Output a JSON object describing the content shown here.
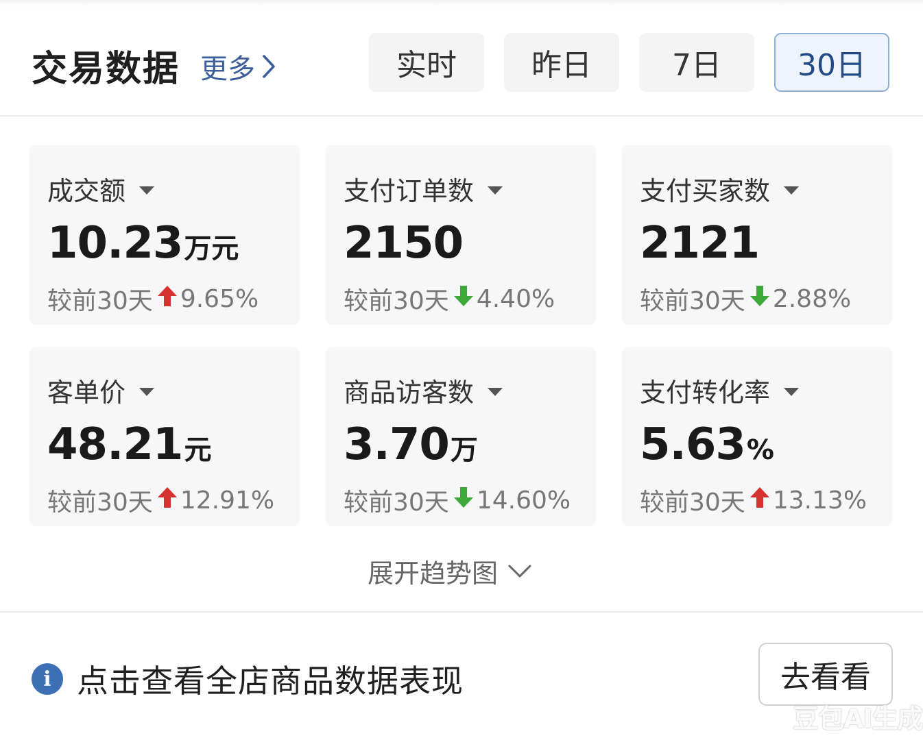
{
  "header": {
    "title": "交易数据",
    "more_label": "更多",
    "tabs": [
      {
        "label": "实时",
        "active": false
      },
      {
        "label": "昨日",
        "active": false
      },
      {
        "label": "7日",
        "active": false
      },
      {
        "label": "30日",
        "active": true
      }
    ]
  },
  "metrics": [
    {
      "label": "成交额",
      "value": "10.23",
      "unit": "万元",
      "compare_text": "较前30天",
      "direction": "up",
      "change": "9.65%"
    },
    {
      "label": "支付订单数",
      "value": "2150",
      "unit": "",
      "compare_text": "较前30天",
      "direction": "down",
      "change": "4.40%"
    },
    {
      "label": "支付买家数",
      "value": "2121",
      "unit": "",
      "compare_text": "较前30天",
      "direction": "down",
      "change": "2.88%"
    },
    {
      "label": "客单价",
      "value": "48.21",
      "unit": "元",
      "compare_text": "较前30天",
      "direction": "up",
      "change": "12.91%"
    },
    {
      "label": "商品访客数",
      "value": "3.70",
      "unit": "万",
      "compare_text": "较前30天",
      "direction": "down",
      "change": "14.60%"
    },
    {
      "label": "支付转化率",
      "value": "5.63",
      "unit": "%",
      "compare_text": "较前30天",
      "direction": "up",
      "change": "13.13%"
    }
  ],
  "expand_label": "展开趋势图",
  "footer": {
    "info_icon": "i",
    "text": "点击查看全店商品数据表现",
    "button_label": "去看看"
  },
  "watermark": "豆包AI生成",
  "colors": {
    "up": "#d6322f",
    "down": "#3ea83a",
    "accent": "#3b5e9b",
    "active_tab_bg": "#eef4fb",
    "active_tab_border": "#8eb0d8"
  }
}
